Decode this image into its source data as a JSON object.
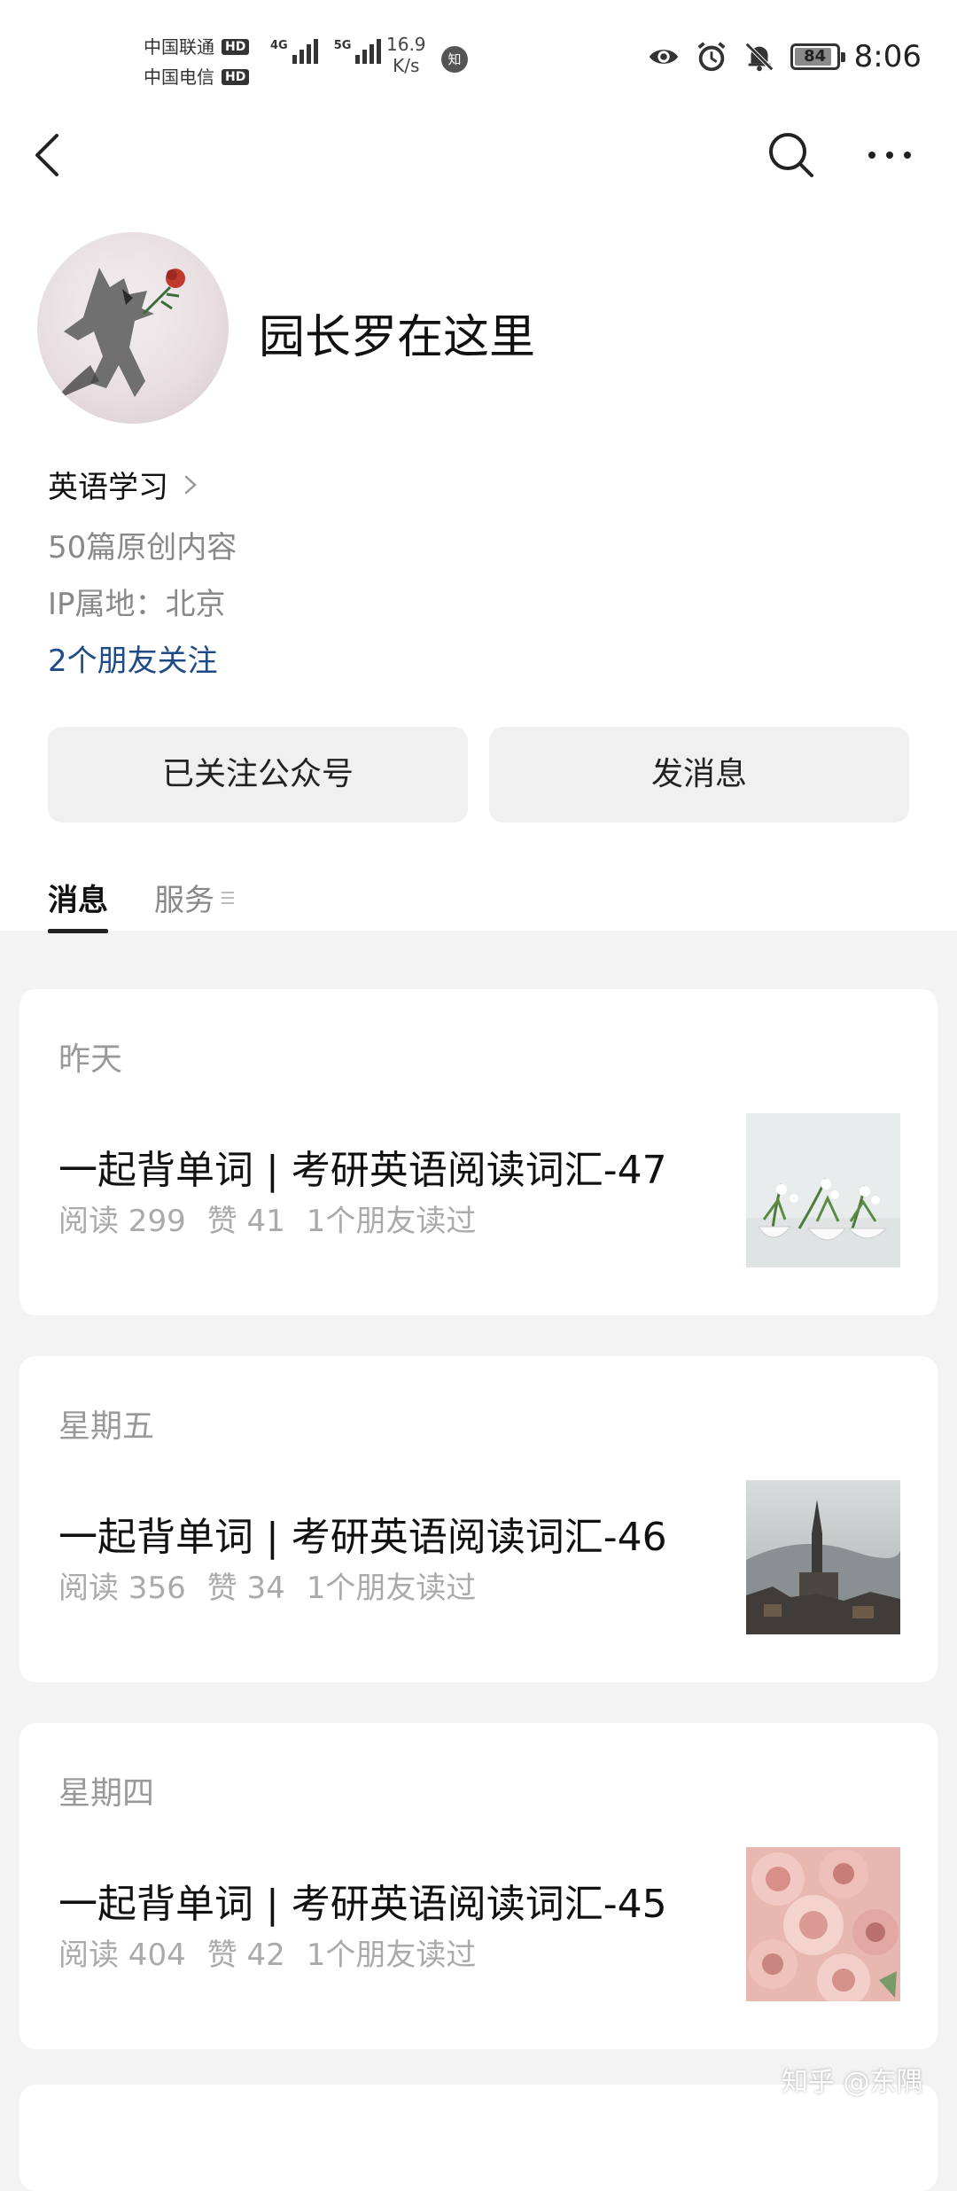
{
  "status_bar": {
    "carrier_1": "中国联通",
    "carrier_2": "中国电信",
    "hd_label": "HD",
    "network_1": "4G",
    "network_2": "5G",
    "speed_value": "16.9",
    "speed_unit": "K/s",
    "app_badge": "知",
    "battery": "84",
    "time": "8:06",
    "icons": [
      "eye-icon",
      "alarm-icon",
      "bell-muted-icon",
      "battery-icon"
    ]
  },
  "nav": {
    "icons": [
      "back-icon",
      "search-icon",
      "more-icon"
    ]
  },
  "profile": {
    "name": "园长罗在这里",
    "category": "英语学习",
    "original_count": "50篇原创内容",
    "ip_location": "IP属地：北京",
    "friends_following": "2个朋友关注"
  },
  "actions": {
    "followed_label": "已关注公众号",
    "message_label": "发消息"
  },
  "tabs": {
    "messages": "消息",
    "services": "服务"
  },
  "articles": [
    {
      "date": "昨天",
      "title": "一起背单词 | 考研英语阅读词汇-47",
      "reads": "阅读 299",
      "likes": "赞 41",
      "friends_read": "1个朋友读过",
      "thumbnail": "snowdrop-flowers-image"
    },
    {
      "date": "星期五",
      "title": "一起背单词 | 考研英语阅读词汇-46",
      "reads": "阅读 356",
      "likes": "赞 34",
      "friends_read": "1个朋友读过",
      "thumbnail": "church-town-image"
    },
    {
      "date": "星期四",
      "title": "一起背单词 | 考研英语阅读词汇-45",
      "reads": "阅读 404",
      "likes": "赞 42",
      "friends_read": "1个朋友读过",
      "thumbnail": "pink-roses-image"
    }
  ],
  "watermark": "知乎 @东隅",
  "colors": {
    "link_blue": "#1e4b86",
    "page_bg": "#f3f3f3",
    "button_bg": "#f0f0f0"
  }
}
